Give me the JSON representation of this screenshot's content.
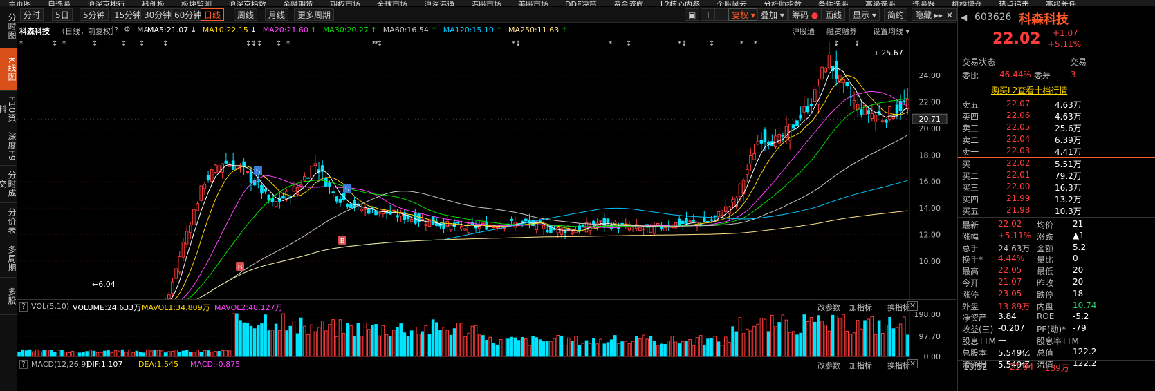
{
  "topmenu": [
    "主页图",
    "自选股",
    "沪深京排行",
    "科创板",
    "板块监测",
    "沪深京指数",
    "金融期货",
    "期权市场",
    "全球市场",
    "沪深港通",
    "港股市场",
    "美股市场",
    "DDE决策",
    "资金流向",
    "L2核心内参",
    "个股风云",
    "分析师指数",
    "条件选股",
    "高级选股",
    "选股器",
    "机构增仓",
    "热点追击",
    "高级长任"
  ],
  "leftbar": [
    "分时图",
    "K线图",
    "F10资料",
    "深度F9",
    "分时成交",
    "分价表",
    "多周期",
    "多股"
  ],
  "tabs": [
    "分时",
    "5日",
    "5分钟",
    "15分钟",
    "30分钟",
    "60分钟",
    "日线",
    "周线",
    "月线",
    "更多周期"
  ],
  "tools": {
    "restore": "复权",
    "overlay": "叠加",
    "chips": "筹码",
    "draw": "画线",
    "display": "显示",
    "simple": "简约",
    "hide": "隐藏"
  },
  "chart_header": {
    "name": "科森科技",
    "mode": "（日线，前复权）",
    "ma_label": "MA",
    "ma": [
      {
        "label": "MA5:21.07",
        "arrow": "↓",
        "color": "#ffffff"
      },
      {
        "label": "MA10:22.15",
        "arrow": "↓",
        "color": "#ffd800"
      },
      {
        "label": "MA20:21.60",
        "arrow": "↑",
        "color": "#ff44ff"
      },
      {
        "label": "MA30:20.27",
        "arrow": "↑",
        "color": "#00e000"
      },
      {
        "label": "MA60:16.54",
        "arrow": "↑",
        "color": "#c8c8c8"
      },
      {
        "label": "MA120:15.10",
        "arrow": "↑",
        "color": "#00c8ff"
      },
      {
        "label": "MA250:11.63",
        "arrow": "↑",
        "color": "#ffe08a"
      }
    ],
    "links": [
      "沪股通",
      "融资融券",
      "设置均线"
    ]
  },
  "chart_data": {
    "type": "candlestick",
    "price_axis": [
      "24.00",
      "22.00",
      "20.00",
      "18.00",
      "16.00",
      "14.00",
      "12.00",
      "10.00"
    ],
    "current_price_tag": "20.71",
    "high_marker": "25.67",
    "low_marker": "6.04",
    "signals": [
      "S",
      "S",
      "B",
      "B"
    ],
    "volume_axis": [
      "198.00",
      "97.70",
      "0.00"
    ]
  },
  "vol_header": {
    "name": "VOL(5,10)",
    "volume": "VOLUME:24.633万",
    "mavol1": "MAVOL1:34.809万",
    "mavol2": "MAVOL2:48.127万",
    "links": [
      "改参数",
      "加指标",
      "换指标"
    ]
  },
  "macd_header": {
    "name": "MACD(12,26,9)",
    "dif": "DIF:1.107",
    "dea": "DEA:1.545",
    "macd": "MACD:-0.875",
    "links": [
      "改参数",
      "加指标",
      "换指标"
    ]
  },
  "quote": {
    "code": "603626",
    "name": "科森科技",
    "price": "22.02",
    "change": "+1.07",
    "change_pct": "+5.11%",
    "trade_status": "交易状态",
    "trade_status2": "交易",
    "weibi_label": "委比",
    "weibi": "46.44%",
    "weicha_label": "委差",
    "weicha": "3",
    "l2_banner": "购买L2查看十档行情",
    "asks": [
      {
        "label": "卖五",
        "price": "22.07",
        "vol": "4.63万"
      },
      {
        "label": "卖四",
        "price": "22.06",
        "vol": "4.63万"
      },
      {
        "label": "卖三",
        "price": "22.05",
        "vol": "25.6万"
      },
      {
        "label": "卖二",
        "price": "22.04",
        "vol": "6.39万"
      },
      {
        "label": "卖一",
        "price": "22.03",
        "vol": "4.41万"
      }
    ],
    "bids": [
      {
        "label": "买一",
        "price": "22.02",
        "vol": "5.51万"
      },
      {
        "label": "买二",
        "price": "22.01",
        "vol": "79.2万"
      },
      {
        "label": "买三",
        "price": "22.00",
        "vol": "16.3万"
      },
      {
        "label": "买四",
        "price": "21.99",
        "vol": "13.2万"
      },
      {
        "label": "买五",
        "price": "21.98",
        "vol": "10.3万"
      }
    ],
    "stats": [
      {
        "l": "最新",
        "v": "22.02",
        "l2": "均价",
        "v2": "21"
      },
      {
        "l": "涨幅",
        "v": "+5.11%",
        "l2": "涨跌",
        "v2": "▲1"
      },
      {
        "l": "总手",
        "v": "24.63万",
        "l2": "金额",
        "v2": "5.2"
      },
      {
        "l": "换手*",
        "v": "4.44%",
        "l2": "量比",
        "v2": "0"
      },
      {
        "l": "最高",
        "v": "22.05",
        "l2": "最低",
        "v2": "20"
      },
      {
        "l": "今开",
        "v": "21.07",
        "l2": "昨收",
        "v2": "20"
      },
      {
        "l": "涨停",
        "v": "23.05",
        "l2": "跌停",
        "v2": "18"
      },
      {
        "l": "外盘",
        "v": "13.89万",
        "l2": "内盘",
        "v2": "10.74"
      },
      {
        "l": "净资产",
        "v": "3.84",
        "l2": "ROE",
        "v2": "-5.2"
      },
      {
        "l": "收益(三)",
        "v": "-0.207",
        "l2": "PE(动)*",
        "v2": "-79"
      },
      {
        "l": "股息TTM",
        "v": "—",
        "l2": "股息率TTM",
        "v2": ""
      },
      {
        "l": "总股本",
        "v": "5.549亿",
        "l2": "总值",
        "v2": "122.2"
      },
      {
        "l": "流通股",
        "v": "5.549亿",
        "l2": "流值",
        "v2": "122.2"
      }
    ],
    "tick": {
      "time": "13:52",
      "price": "21.94",
      "vol": "139万"
    }
  },
  "colors": {
    "up": "#ff3b3b",
    "down": "#00e5ff",
    "accent": "#ff5b2a"
  }
}
